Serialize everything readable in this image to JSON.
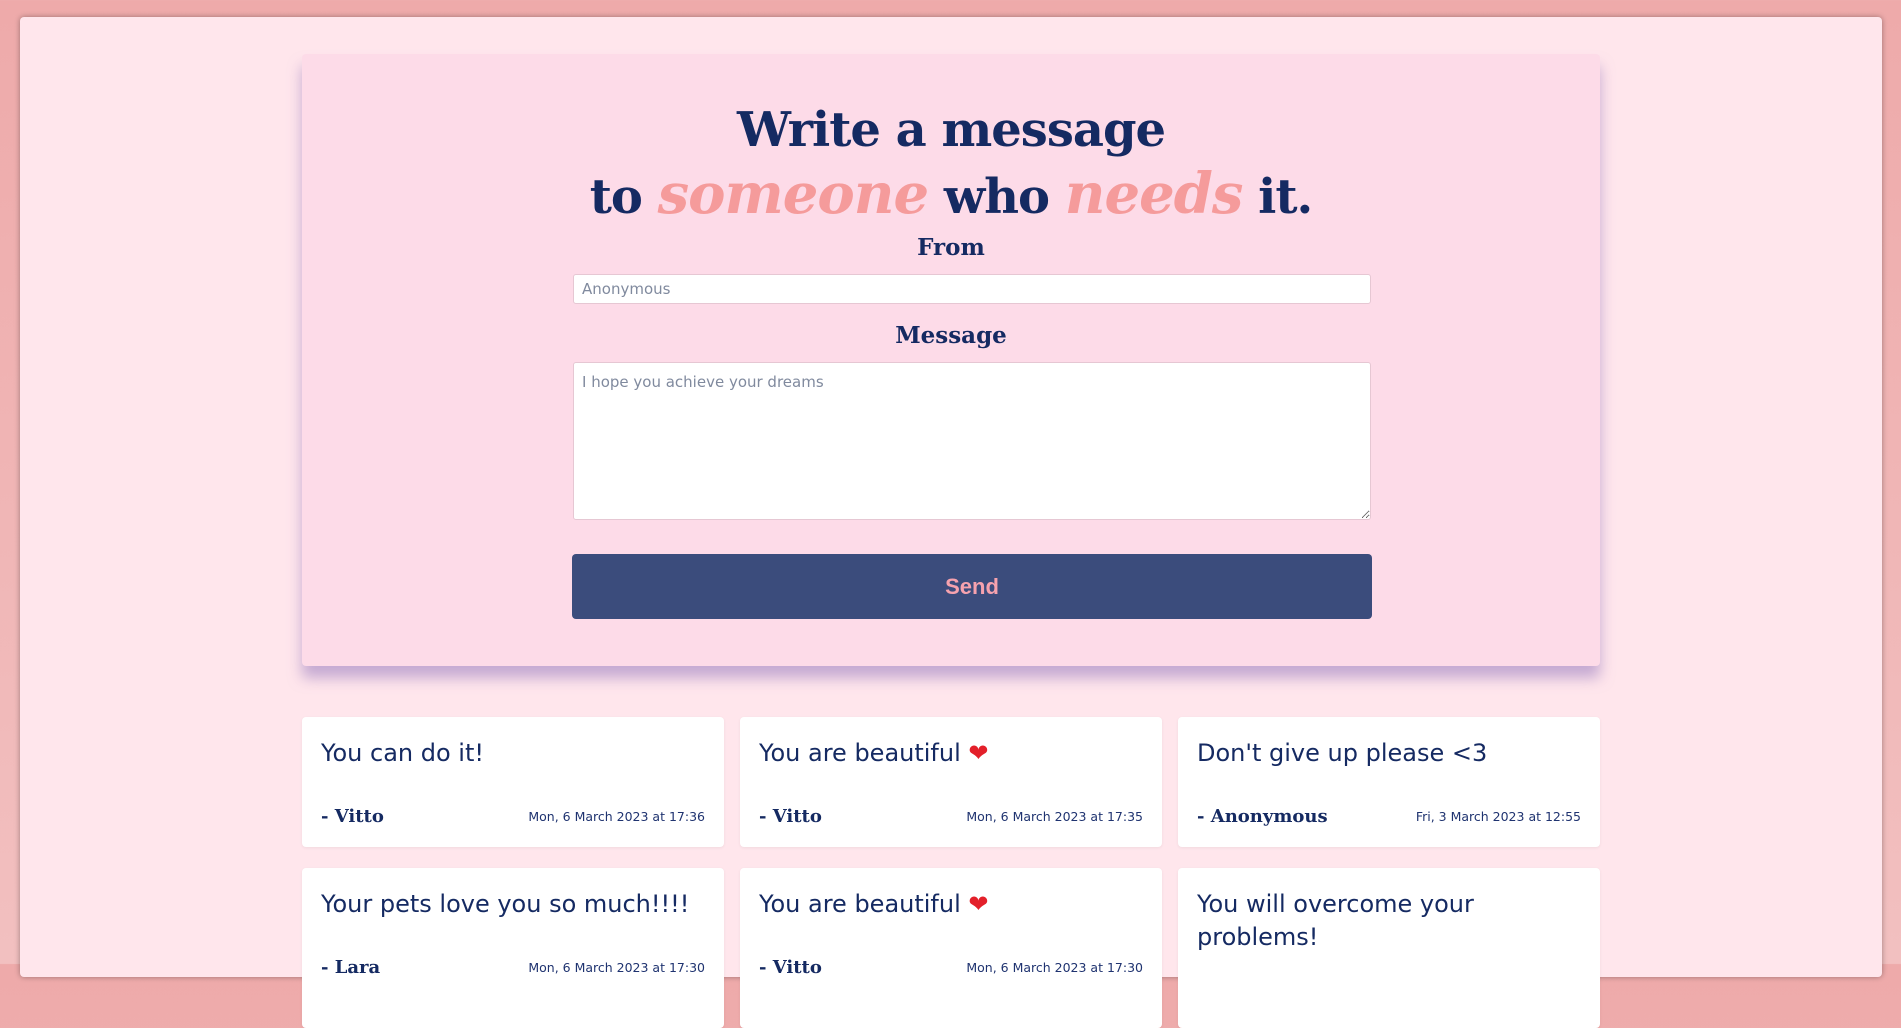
{
  "header": {
    "title_line1": "Write a message",
    "title_to": "to",
    "title_someone": "someone",
    "title_who": "who",
    "title_needs": "needs",
    "title_it": "it."
  },
  "form": {
    "from_label": "From",
    "from_placeholder": "Anonymous",
    "message_label": "Message",
    "message_placeholder": "I hope you achieve your dreams",
    "send_label": "Send"
  },
  "messages": [
    {
      "text": "You can do it!",
      "heart": false,
      "author": "- Vitto",
      "date": "Mon, 6 March 2023 at 17:36"
    },
    {
      "text": "You are beautiful",
      "heart": true,
      "author": "- Vitto",
      "date": "Mon, 6 March 2023 at 17:35"
    },
    {
      "text": "Don't give up please <3",
      "heart": false,
      "author": "- Anonymous",
      "date": "Fri, 3 March 2023 at 12:55"
    },
    {
      "text": "Your pets love you so much!!!!",
      "heart": false,
      "author": "- Lara",
      "date": "Mon, 6 March 2023 at 17:30"
    },
    {
      "text": "You are beautiful",
      "heart": true,
      "author": "- Vitto",
      "date": "Mon, 6 March 2023 at 17:30"
    },
    {
      "text": "You will overcome your problems!",
      "heart": false,
      "author": "",
      "date": ""
    }
  ],
  "icons": {
    "heart": "red-heart-icon"
  },
  "colors": {
    "navy": "#152a62",
    "accent_pink": "#f59b9b",
    "button_bg": "#3b4c7c",
    "panel_bg": "#fddbe8",
    "page_bg": "#ffe6ec"
  }
}
